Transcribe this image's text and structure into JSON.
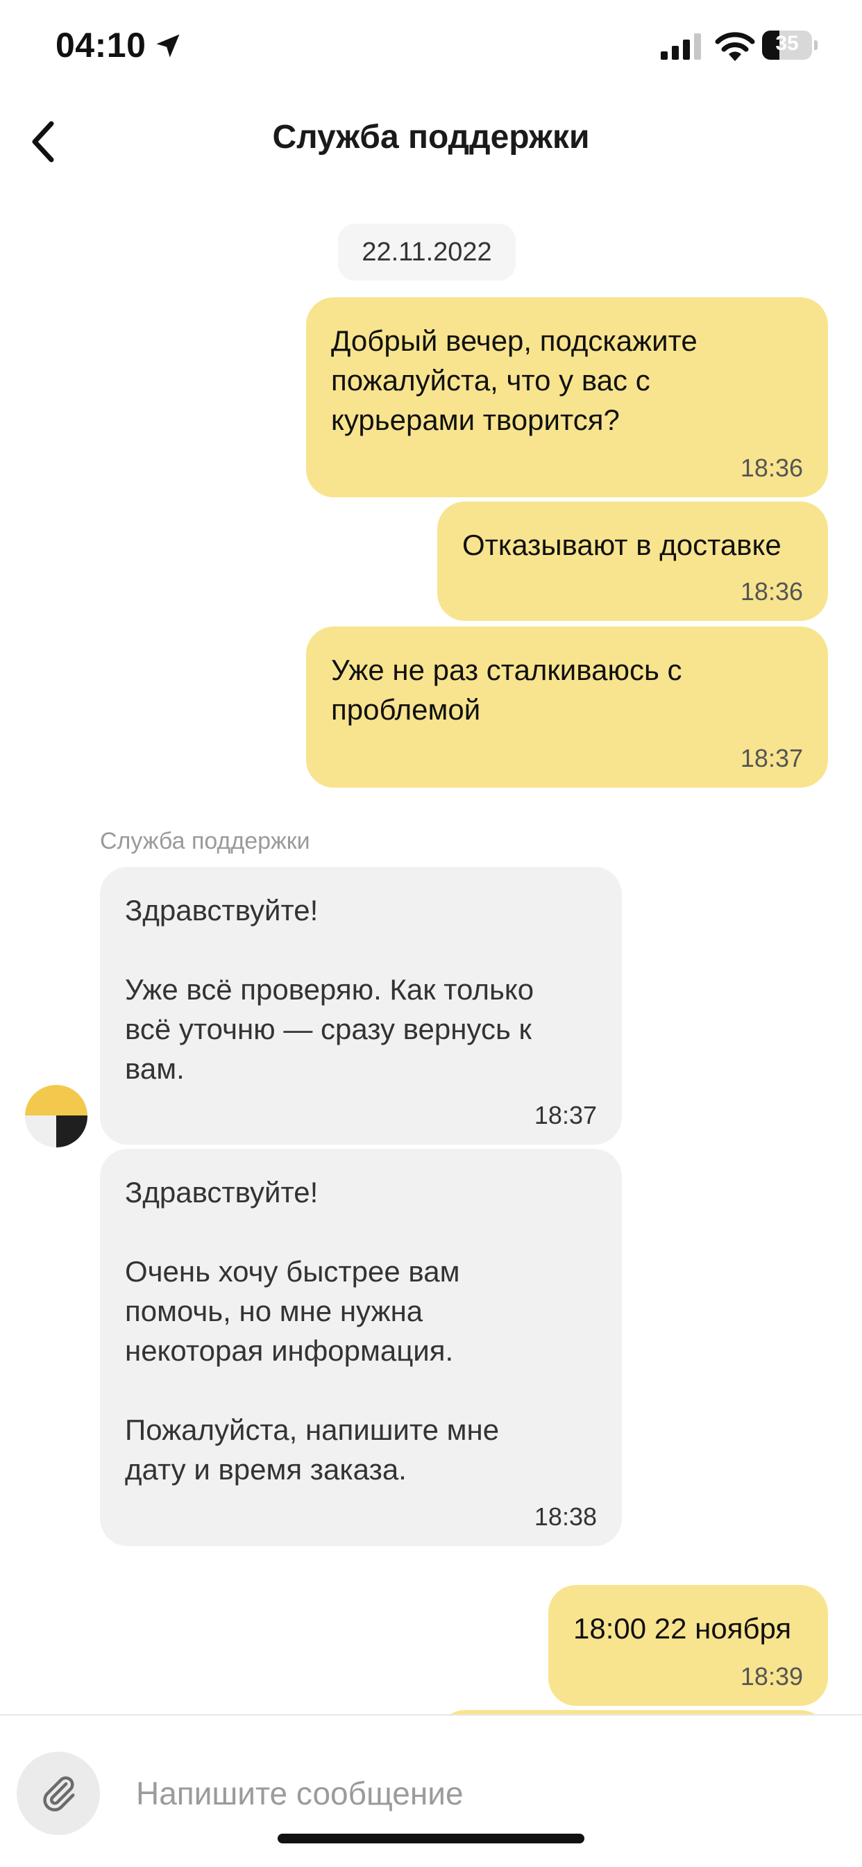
{
  "status_bar": {
    "time": "04:10",
    "battery": "35",
    "battery_level": 0.35
  },
  "header": {
    "title": "Служба поддержки"
  },
  "chat": {
    "date": "22.11.2022",
    "sender_name": "Служба поддержки",
    "messages": [
      {
        "direction": "out",
        "text": "Добрый вечер, подскажите\nпожалуйста, что у вас с\nкурьерами творится?",
        "time": "18:36"
      },
      {
        "direction": "out",
        "text": "Отказывают в доставке",
        "time": "18:36"
      },
      {
        "direction": "out",
        "text": "Уже не раз сталкиваюсь с\nпроблемой",
        "time": "18:37"
      },
      {
        "direction": "in",
        "text": "Здравствуйте!\n\nУже всё проверяю. Как только\nвсё уточню — сразу вернусь к\nвам.",
        "time": "18:37"
      },
      {
        "direction": "in",
        "text": "Здравствуйте!\n\nОчень хочу быстрее вам\nпомочь, но мне нужна\nнекоторая информация.\n\nПожалуйста, напишите мне\nдату и время заказа.",
        "time": "18:38"
      },
      {
        "direction": "out",
        "text": "18:00 22 ноября",
        "time": "18:39"
      }
    ]
  },
  "composer": {
    "placeholder": "Напишите сообщение"
  },
  "icons": {
    "back": "chevron-left-icon",
    "attach": "paperclip-icon",
    "location": "location-arrow-icon",
    "signal": "signal-icon",
    "wifi": "wifi-icon"
  },
  "colors": {
    "outgoing_bubble": "#f8e48e",
    "incoming_bubble": "#f1f1f1",
    "avatar_yellow": "#f2c94c"
  }
}
